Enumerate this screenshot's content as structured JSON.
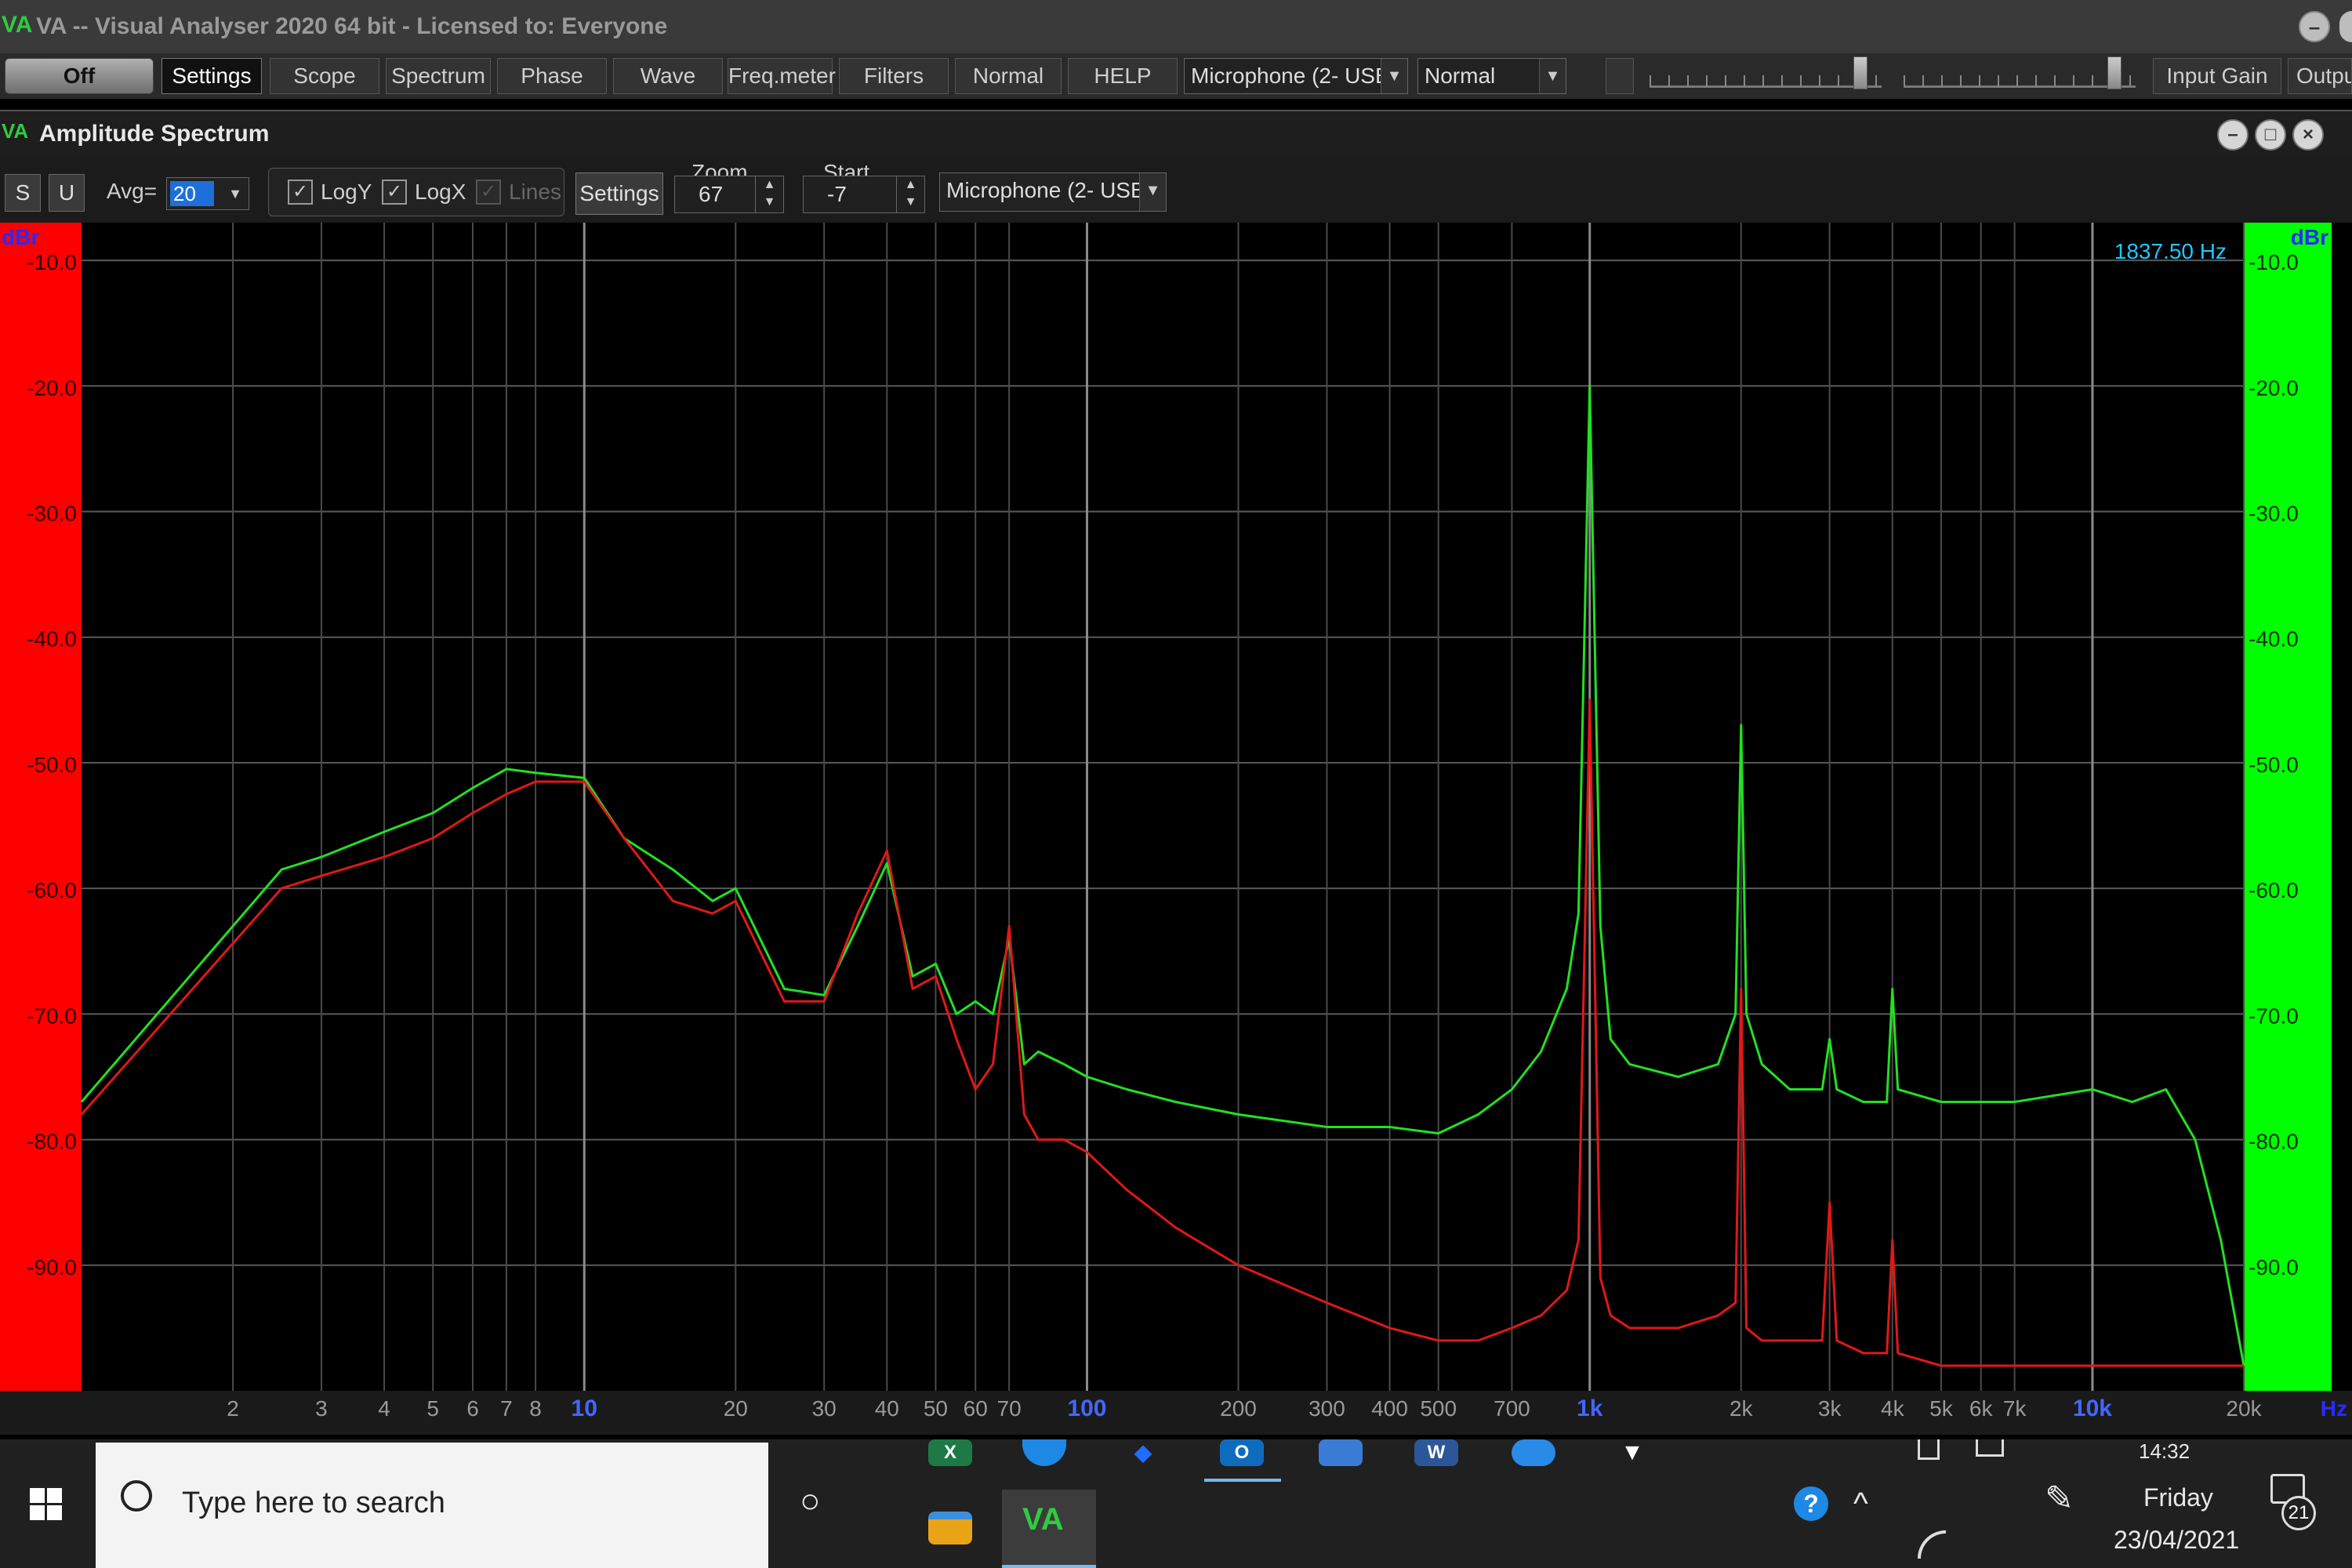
{
  "window": {
    "logo": "VA",
    "logo_sub": "64",
    "title": "VA -- Visual Analyser 2020 64 bit - Licensed to: Everyone",
    "minimize_glyph": "–",
    "close_glyph": "×"
  },
  "toolbar": {
    "off": "Off",
    "settings": "Settings",
    "scope": "Scope",
    "spectrum": "Spectrum",
    "phase": "Phase",
    "wave": "Wave",
    "freqmeter": "Freq.meter",
    "filters": "Filters",
    "normal": "Normal",
    "help": "HELP",
    "input_device": "Microphone (2- USB",
    "mode": "Normal",
    "input_gain": "Input Gain",
    "output": "Outpu",
    "input_gain_level": 0.88,
    "output_level": 0.88
  },
  "subwindow": {
    "logo": "VA",
    "title": "Amplitude Spectrum"
  },
  "spectrum_controls": {
    "s": "S",
    "u": "U",
    "avg_label": "Avg=",
    "avg_value": "20",
    "logy": "LogY",
    "logx": "LogX",
    "lines": "Lines",
    "settings": "Settings",
    "zoom_label": "Zoom",
    "zoom_value": "67",
    "start_label": "Start",
    "start_value": "-7",
    "device": "Microphone (2- USB"
  },
  "chart_data": {
    "type": "line",
    "ylabel_left": "dBr",
    "ylabel_right": "dBr",
    "xlabel": "Hz",
    "cursor_readout": "1837.50 Hz",
    "x_scale": "log",
    "xlim": [
      1,
      20000
    ],
    "ylim": [
      -100,
      -7
    ],
    "grid": true,
    "y_ticks": [
      "-10.0",
      "-20.0",
      "-30.0",
      "-40.0",
      "-50.0",
      "-60.0",
      "-70.0",
      "-80.0",
      "-90.0"
    ],
    "y_tick_values": [
      -10,
      -20,
      -30,
      -40,
      -50,
      -60,
      -70,
      -80,
      -90
    ],
    "x_tick_values": [
      2,
      3,
      4,
      5,
      6,
      7,
      8,
      10,
      20,
      30,
      40,
      50,
      60,
      70,
      100,
      200,
      300,
      400,
      500,
      700,
      1000,
      2000,
      3000,
      4000,
      5000,
      6000,
      7000,
      10000,
      20000
    ],
    "x_tick_labels": [
      "2",
      "3",
      "4",
      "5",
      "6",
      "7",
      "8",
      "10",
      "20",
      "30",
      "40",
      "50",
      "60",
      "70",
      "100",
      "200",
      "300",
      "400",
      "500",
      "700",
      "1k",
      "2k",
      "3k",
      "4k",
      "5k",
      "6k",
      "7k",
      "10k",
      "20k"
    ],
    "x_tick_major": [
      false,
      false,
      false,
      false,
      false,
      false,
      false,
      true,
      false,
      false,
      false,
      false,
      false,
      false,
      true,
      false,
      false,
      false,
      false,
      false,
      true,
      false,
      false,
      false,
      false,
      false,
      false,
      true,
      false
    ],
    "series": [
      {
        "color": "#22e022",
        "x": [
          1,
          2.5,
          3,
          4,
          5,
          6,
          7,
          8,
          10,
          12,
          15,
          18,
          20,
          25,
          30,
          35,
          40,
          45,
          50,
          55,
          60,
          65,
          70,
          75,
          80,
          90,
          100,
          120,
          150,
          200,
          300,
          400,
          500,
          600,
          700,
          800,
          900,
          950,
          1000,
          1050,
          1100,
          1200,
          1500,
          1800,
          1950,
          2000,
          2050,
          2200,
          2500,
          2900,
          3000,
          3100,
          3500,
          3900,
          4000,
          4100,
          5000,
          7000,
          10000,
          12000,
          14000,
          16000,
          18000,
          20000
        ],
        "y": [
          -77,
          -58.5,
          -57.5,
          -55.5,
          -54,
          -52,
          -50.5,
          -50.8,
          -51.2,
          -56,
          -58.5,
          -61,
          -60,
          -68,
          -68.5,
          -63,
          -58,
          -67,
          -66,
          -70,
          -69,
          -70,
          -64,
          -74,
          -73,
          -74,
          -75,
          -76,
          -77,
          -78,
          -79,
          -79,
          -79.5,
          -78,
          -76,
          -73,
          -68,
          -62,
          -20,
          -63,
          -72,
          -74,
          -75,
          -74,
          -70,
          -47,
          -70,
          -74,
          -76,
          -76,
          -72,
          -76,
          -77,
          -77,
          -68,
          -76,
          -77,
          -77,
          -76,
          -77,
          -76,
          -80,
          -88,
          -98
        ]
      },
      {
        "color": "#e01818",
        "x": [
          1,
          2.5,
          3,
          4,
          5,
          6,
          7,
          8,
          10,
          12,
          15,
          18,
          20,
          25,
          30,
          35,
          40,
          45,
          50,
          55,
          60,
          65,
          70,
          75,
          80,
          90,
          100,
          120,
          150,
          200,
          300,
          400,
          500,
          600,
          700,
          800,
          900,
          950,
          1000,
          1050,
          1100,
          1200,
          1500,
          1800,
          1950,
          2000,
          2050,
          2200,
          2500,
          2900,
          3000,
          3100,
          3500,
          3900,
          4000,
          4100,
          5000,
          7000,
          10000,
          12000,
          14000,
          16000,
          18000,
          20000
        ],
        "y": [
          -78,
          -60,
          -59,
          -57.5,
          -56,
          -54,
          -52.5,
          -51.5,
          -51.5,
          -56,
          -61,
          -62,
          -61,
          -69,
          -69,
          -62,
          -57,
          -68,
          -67,
          -72,
          -76,
          -74,
          -63,
          -78,
          -80,
          -80,
          -81,
          -84,
          -87,
          -90,
          -93,
          -95,
          -96,
          -96,
          -95,
          -94,
          -92,
          -88,
          -45,
          -91,
          -94,
          -95,
          -95,
          -94,
          -93,
          -68,
          -95,
          -96,
          -96,
          -96,
          -85,
          -96,
          -97,
          -97,
          -88,
          -97,
          -98,
          -98,
          -98,
          -98,
          -98,
          -98,
          -98,
          -98
        ]
      }
    ]
  },
  "taskbar": {
    "search_placeholder": "Type here to search",
    "cortana_glyph": "○",
    "clock_time": "14:32",
    "clock_day": "Friday",
    "clock_date": "23/04/2021",
    "notification_count": "21",
    "help_glyph": "?",
    "chevron_glyph": "^",
    "va_icon": "VA",
    "excel_icon": "X",
    "word_icon": "W",
    "outlook_icon": "O"
  }
}
